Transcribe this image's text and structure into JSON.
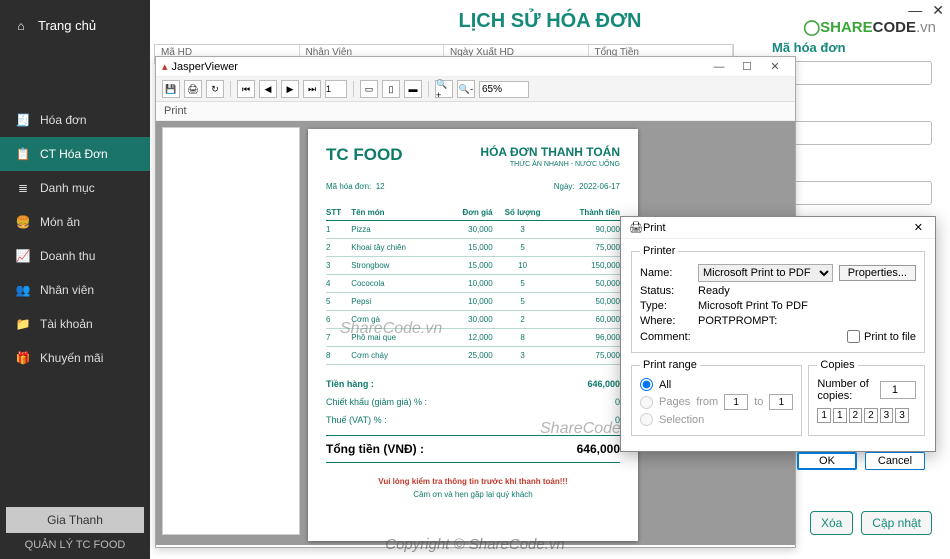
{
  "window_controls": {
    "min": "—",
    "close": "✕"
  },
  "watermark_logo": {
    "s": "SHARE",
    "c": "CODE",
    "v": ".vn"
  },
  "sidebar": {
    "home": "Trang chủ",
    "items": [
      {
        "icon": "🧾",
        "label": "Hóa đơn"
      },
      {
        "icon": "📋",
        "label": "CT Hóa Đơn"
      },
      {
        "icon": "≣",
        "label": "Danh mục"
      },
      {
        "icon": "🍔",
        "label": "Món ăn"
      },
      {
        "icon": "📈",
        "label": "Doanh thu"
      },
      {
        "icon": "👥",
        "label": "Nhân viên"
      },
      {
        "icon": "📁",
        "label": "Tài khoản"
      },
      {
        "icon": "🎁",
        "label": "Khuyến mãi"
      }
    ],
    "user": "Gia Thanh",
    "brand": "QUẢN LÝ TC FOOD"
  },
  "main": {
    "title": "LỊCH SỬ HÓA ĐƠN"
  },
  "side_form": {
    "label": "Mã hóa đơn",
    "delete": "Xóa",
    "update": "Cập nhật"
  },
  "bg_headers": [
    "Mã HD",
    "Nhân Viên",
    "Ngày Xuất HD",
    "Tổng Tiền"
  ],
  "viewer": {
    "title": "JasperViewer",
    "zoom": "65%",
    "page_num": "1",
    "sublabel": "Print"
  },
  "invoice": {
    "brand": "TC FOOD",
    "title": "HÓA ĐƠN THANH TOÁN",
    "subtitle": "THỨC ĂN NHANH - NƯỚC UỐNG",
    "id_label": "Mã hóa đơn:",
    "id": "12",
    "date_label": "Ngày:",
    "date": "2022-06-17",
    "cols": {
      "stt": "STT",
      "name": "Tên món",
      "price": "Đơn giá",
      "qty": "Số lượng",
      "total": "Thành tiền"
    },
    "rows": [
      {
        "stt": "1",
        "name": "Pizza",
        "price": "30,000",
        "qty": "3",
        "total": "90,000"
      },
      {
        "stt": "2",
        "name": "Khoai tây chiên",
        "price": "15,000",
        "qty": "5",
        "total": "75,000"
      },
      {
        "stt": "3",
        "name": "Strongbow",
        "price": "15,000",
        "qty": "10",
        "total": "150,000"
      },
      {
        "stt": "4",
        "name": "Cococola",
        "price": "10,000",
        "qty": "5",
        "total": "50,000"
      },
      {
        "stt": "5",
        "name": "Pepsi",
        "price": "10,000",
        "qty": "5",
        "total": "50,000"
      },
      {
        "stt": "6",
        "name": "Cơm gà",
        "price": "30,000",
        "qty": "2",
        "total": "60,000"
      },
      {
        "stt": "7",
        "name": "Phô mai que",
        "price": "12,000",
        "qty": "8",
        "total": "96,000"
      },
      {
        "stt": "8",
        "name": "Cơm cháy",
        "price": "25,000",
        "qty": "3",
        "total": "75,000"
      }
    ],
    "subtotal_label": "Tiền hàng :",
    "subtotal": "646,000",
    "discount_label": "Chiết khấu (giảm giá) % :",
    "discount": "0",
    "vat_label": "Thuế (VAT) % :",
    "vat": "0",
    "grand_label": "Tổng tiền (VNĐ) :",
    "grand": "646,000",
    "note": "Vui lòng kiểm tra thông tin trước khi thanh toán!!!",
    "thanks": "Cảm ơn và hẹn gặp lại quý khách"
  },
  "print": {
    "title": "Print",
    "printer_legend": "Printer",
    "name_label": "Name:",
    "printer_name": "Microsoft Print to PDF",
    "properties": "Properties...",
    "status_label": "Status:",
    "status": "Ready",
    "type_label": "Type:",
    "type": "Microsoft Print To PDF",
    "where_label": "Where:",
    "where": "PORTPROMPT:",
    "comment_label": "Comment:",
    "print_to_file": "Print to file",
    "range_legend": "Print range",
    "all": "All",
    "pages": "Pages",
    "from": "from",
    "to": "to",
    "from_val": "1",
    "to_val": "1",
    "selection": "Selection",
    "copies_legend": "Copies",
    "copies_label": "Number of copies:",
    "copies": "1",
    "ok": "OK",
    "cancel": "Cancel"
  },
  "watermarks": {
    "w1": "ShareCode.vn",
    "w2": "ShareCode.vn",
    "copyright": "Copyright © ShareCode.vn"
  }
}
